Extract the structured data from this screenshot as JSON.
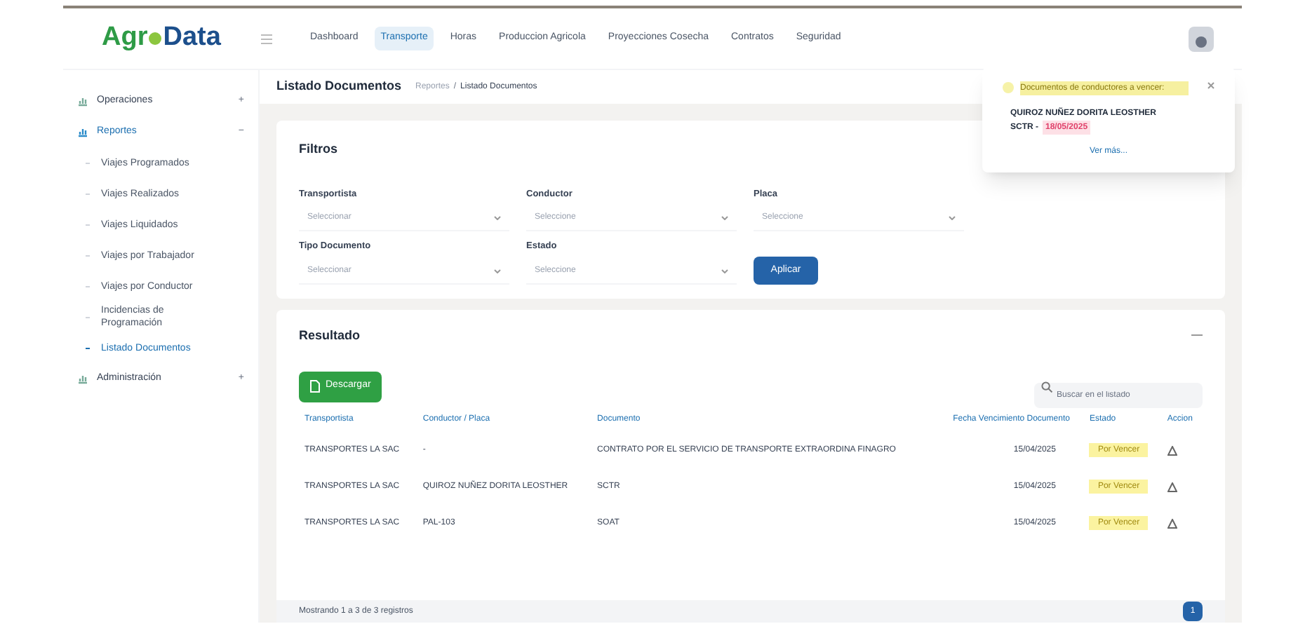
{
  "logo": {
    "text_a": "Agr",
    "text_b": "Data"
  },
  "nav": [
    {
      "label": "Dashboard",
      "selected": false
    },
    {
      "label": "Transporte",
      "selected": true
    },
    {
      "label": "Horas",
      "selected": false
    },
    {
      "label": "Produccion Agricola",
      "selected": false
    },
    {
      "label": "Proyecciones Cosecha",
      "selected": false
    },
    {
      "label": "Contratos",
      "selected": false
    },
    {
      "label": "Seguridad",
      "selected": false
    }
  ],
  "sidebar": {
    "items": [
      {
        "label": "Operaciones",
        "toggle": "+",
        "expanded": false
      },
      {
        "label": "Reportes",
        "toggle": "−",
        "expanded": true,
        "children": [
          {
            "label": "Viajes Programados",
            "selected": false
          },
          {
            "label": "Viajes Realizados",
            "selected": false
          },
          {
            "label": "Viajes Liquidados",
            "selected": false
          },
          {
            "label": "Viajes por Trabajador",
            "selected": false
          },
          {
            "label": "Viajes por Conductor",
            "selected": false
          },
          {
            "label": "Incidencias de Programación",
            "selected": false
          },
          {
            "label": "Listado Documentos",
            "selected": true
          }
        ]
      },
      {
        "label": "Administración",
        "toggle": "+",
        "expanded": false
      }
    ]
  },
  "page": {
    "title": "Listado Documentos",
    "separator": "/",
    "breadcrumb": [
      {
        "label": "Reportes"
      },
      {
        "label": "Listado Documentos"
      }
    ]
  },
  "filters": {
    "title": "Filtros",
    "fields": [
      {
        "label": "Transportista",
        "placeholder": "Seleccionar"
      },
      {
        "label": "Conductor",
        "placeholder": "Seleccione"
      },
      {
        "label": "Placa",
        "placeholder": "Seleccione"
      },
      {
        "label": "Tipo Documento",
        "placeholder": "Seleccionar"
      },
      {
        "label": "Estado",
        "placeholder": "Seleccione"
      }
    ],
    "apply": "Aplicar"
  },
  "results": {
    "title": "Resultado",
    "download": "Descargar",
    "search": {
      "placeholder": "Buscar en el listado"
    },
    "columns": [
      "Transportista",
      "Conductor / Placa",
      "Documento",
      "Fecha Vencimiento Documento",
      "Estado",
      "Accion"
    ],
    "rows": [
      {
        "cells": [
          "TRANSPORTES LA SAC",
          "-",
          "CONTRATO POR EL SERVICIO DE TRANSPORTE EXTRAORDINA FINAGRO",
          "15/04/2025"
        ],
        "status": "Por Vencer"
      },
      {
        "cells": [
          "TRANSPORTES LA SAC",
          "QUIROZ NUÑEZ DORITA LEOSTHER",
          "SCTR",
          "15/04/2025"
        ],
        "status": "Por Vencer"
      },
      {
        "cells": [
          "TRANSPORTES LA SAC",
          "PAL-103",
          "SOAT",
          "15/04/2025"
        ],
        "status": "Por Vencer"
      }
    ],
    "pagination": {
      "info": "Mostrando 1 a 3 de 3 registros",
      "pages": [
        {
          "label": "1",
          "selected": true
        }
      ]
    }
  },
  "notification": {
    "title": "Documentos de conductores a vencer:",
    "items": [
      {
        "name": "QUIROZ NUÑEZ DORITA LEOSTHER",
        "doc": "SCTR -",
        "date": "18/05/2025"
      }
    ],
    "link": "Ver más..."
  }
}
